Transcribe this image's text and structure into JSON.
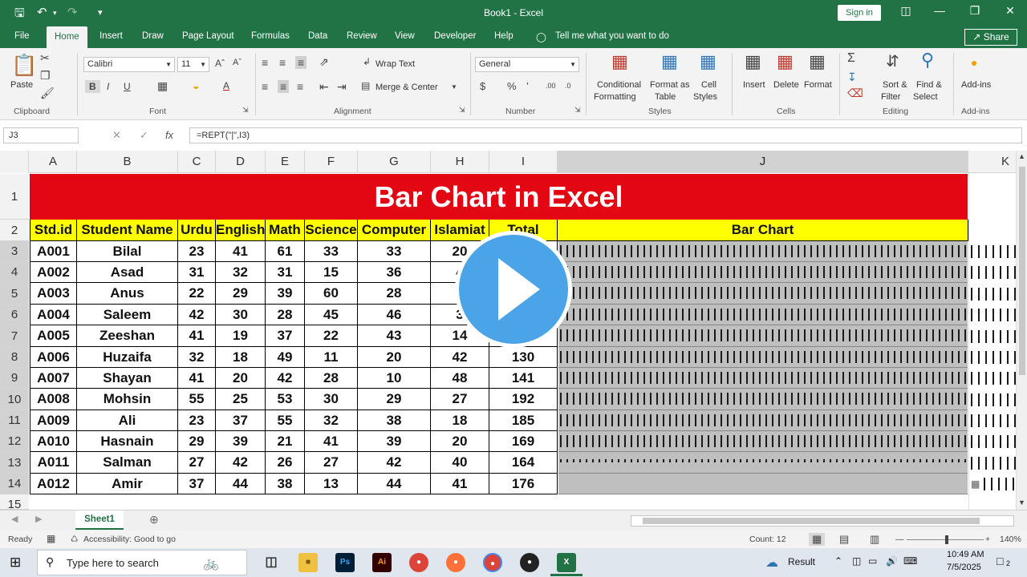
{
  "titlebar": {
    "title": "Book1 - Excel",
    "signin": "Sign in"
  },
  "menu": {
    "tabs": [
      "File",
      "Home",
      "Insert",
      "Draw",
      "Page Layout",
      "Formulas",
      "Data",
      "Review",
      "View",
      "Developer",
      "Help"
    ],
    "tellme": "Tell me what you want to do",
    "share": "Share"
  },
  "ribbon": {
    "paste": "Paste",
    "font_name": "Calibri",
    "font_size": "11",
    "wrap_text": "Wrap Text",
    "merge_center": "Merge & Center",
    "number_format": "General",
    "conditional_formatting": [
      "Conditional",
      "Formatting"
    ],
    "format_as_table": [
      "Format as",
      "Table"
    ],
    "cell_styles": [
      "Cell",
      "Styles"
    ],
    "insert": "Insert",
    "delete": "Delete",
    "format": "Format",
    "sort_filter": [
      "Sort &",
      "Filter"
    ],
    "find_select": [
      "Find &",
      "Select"
    ],
    "addins": "Add-ins",
    "groups": [
      "Clipboard",
      "Font",
      "Alignment",
      "Number",
      "Styles",
      "Cells",
      "Editing",
      "Add-ins"
    ]
  },
  "formula_bar": {
    "name_box": "J3",
    "fx": "fx",
    "formula": "=REPT(\"|\",I3)"
  },
  "columns": [
    "A",
    "B",
    "C",
    "D",
    "E",
    "F",
    "G",
    "H",
    "I",
    "J",
    "K"
  ],
  "rows": [
    "1",
    "2",
    "3",
    "4",
    "5",
    "6",
    "7",
    "8",
    "9",
    "10",
    "11",
    "12",
    "13",
    "14",
    "15"
  ],
  "sheet": {
    "title": "Bar Chart in Excel",
    "headers": [
      "Std.id",
      "Student Name",
      "Urdu",
      "English",
      "Math",
      "Science",
      "Computer",
      "Islamiat",
      "Total",
      "Bar Chart"
    ],
    "records": [
      [
        "A001",
        "Bilal",
        "23",
        "41",
        "61",
        "33",
        "33",
        "20",
        ""
      ],
      [
        "A002",
        "Asad",
        "31",
        "32",
        "31",
        "15",
        "36",
        "4",
        ""
      ],
      [
        "A003",
        "Anus",
        "22",
        "29",
        "39",
        "60",
        "28",
        "3",
        ""
      ],
      [
        "A004",
        "Saleem",
        "42",
        "30",
        "28",
        "45",
        "46",
        "3",
        ""
      ],
      [
        "A005",
        "Zeeshan",
        "41",
        "19",
        "37",
        "22",
        "43",
        "14",
        ""
      ],
      [
        "A006",
        "Huzaifa",
        "32",
        "18",
        "49",
        "11",
        "20",
        "42",
        "130"
      ],
      [
        "A007",
        "Shayan",
        "41",
        "20",
        "42",
        "28",
        "10",
        "48",
        "141"
      ],
      [
        "A008",
        "Mohsin",
        "55",
        "25",
        "53",
        "30",
        "29",
        "27",
        "192"
      ],
      [
        "A009",
        "Ali",
        "23",
        "37",
        "55",
        "32",
        "38",
        "18",
        "185"
      ],
      [
        "A010",
        "Hasnain",
        "29",
        "39",
        "21",
        "41",
        "39",
        "20",
        "169"
      ],
      [
        "A011",
        "Salman",
        "27",
        "42",
        "26",
        "27",
        "42",
        "40",
        "164"
      ],
      [
        "A012",
        "Amir",
        "37",
        "44",
        "38",
        "13",
        "44",
        "41",
        "176"
      ]
    ],
    "tab_name": "Sheet1"
  },
  "status": {
    "ready": "Ready",
    "accessibility": "Accessibility: Good to go",
    "count": "Count: 12",
    "zoom": "140%"
  },
  "taskbar": {
    "search_placeholder": "Type here to search",
    "result": "Result",
    "time": "10:49 AM",
    "date": "7/5/2025",
    "notif_count": "2"
  }
}
